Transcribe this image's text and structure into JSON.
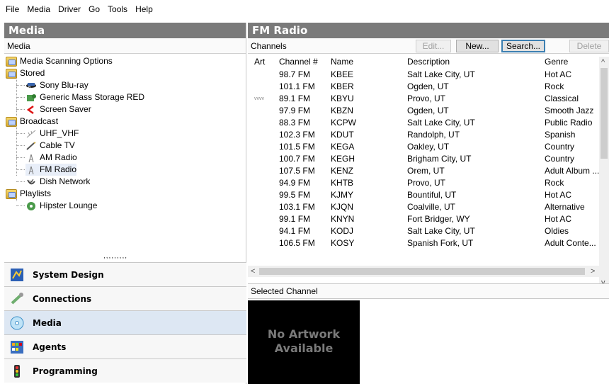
{
  "menu": [
    "File",
    "Media",
    "Driver",
    "Go",
    "Tools",
    "Help"
  ],
  "left": {
    "title": "Media",
    "subheader": "Media",
    "tree": [
      {
        "label": "Media Scanning Options",
        "icon": "folder-icon"
      },
      {
        "label": "Stored",
        "icon": "folder-icon"
      },
      {
        "label": "Sony Blu-ray",
        "icon": "bluray-player-icon"
      },
      {
        "label": "Generic Mass Storage RED",
        "icon": "storage-icon"
      },
      {
        "label": "Screen Saver",
        "icon": "screen-saver-icon"
      },
      {
        "label": "Broadcast",
        "icon": "folder-icon"
      },
      {
        "label": "UHF_VHF",
        "icon": "antenna-icon"
      },
      {
        "label": "Cable TV",
        "icon": "cable-icon"
      },
      {
        "label": "AM Radio",
        "icon": "radio-tower-icon"
      },
      {
        "label": "FM Radio",
        "icon": "radio-tower-icon"
      },
      {
        "label": "Dish Network",
        "icon": "satellite-dish-icon"
      },
      {
        "label": "Playlists",
        "icon": "folder-icon"
      },
      {
        "label": "Hipster Lounge",
        "icon": "playlist-icon"
      }
    ],
    "splitter": ",,,,,,,,,",
    "nav": [
      {
        "label": "System Design",
        "icon": "system-design-icon",
        "active": false
      },
      {
        "label": "Connections",
        "icon": "connections-icon",
        "active": false
      },
      {
        "label": "Media",
        "icon": "media-icon",
        "active": true
      },
      {
        "label": "Agents",
        "icon": "agents-icon",
        "active": false
      },
      {
        "label": "Programming",
        "icon": "programming-icon",
        "active": false
      }
    ]
  },
  "right": {
    "title": "FM Radio",
    "channels_label": "Channels",
    "buttons": {
      "edit": "Edit...",
      "new": "New...",
      "search": "Search...",
      "delete": "Delete"
    },
    "columns": [
      "Art",
      "Channel #",
      "Name",
      "Description",
      "Genre"
    ],
    "rows": [
      {
        "art": "",
        "channel": "98.7 FM",
        "name": "KBEE",
        "description": "Salt Lake City, UT",
        "genre": "Hot AC"
      },
      {
        "art": "",
        "channel": "101.1 FM",
        "name": "KBER",
        "description": "Ogden, UT",
        "genre": "Rock"
      },
      {
        "art": "vvvv",
        "channel": "89.1 FM",
        "name": "KBYU",
        "description": "Provo, UT",
        "genre": "Classical"
      },
      {
        "art": "",
        "channel": "97.9 FM",
        "name": "KBZN",
        "description": "Ogden, UT",
        "genre": "Smooth Jazz"
      },
      {
        "art": "",
        "channel": "88.3 FM",
        "name": "KCPW",
        "description": "Salt Lake City, UT",
        "genre": "Public Radio"
      },
      {
        "art": "",
        "channel": "102.3 FM",
        "name": "KDUT",
        "description": "Randolph, UT",
        "genre": "Spanish"
      },
      {
        "art": "",
        "channel": "101.5 FM",
        "name": "KEGA",
        "description": "Oakley, UT",
        "genre": "Country"
      },
      {
        "art": "",
        "channel": "100.7 FM",
        "name": "KEGH",
        "description": "Brigham City, UT",
        "genre": "Country"
      },
      {
        "art": "",
        "channel": "107.5 FM",
        "name": "KENZ",
        "description": "Orem, UT",
        "genre": "Adult Album ..."
      },
      {
        "art": "",
        "channel": "94.9 FM",
        "name": "KHTB",
        "description": "Provo, UT",
        "genre": "Rock"
      },
      {
        "art": "",
        "channel": "99.5 FM",
        "name": "KJMY",
        "description": "Bountiful, UT",
        "genre": "Hot AC"
      },
      {
        "art": "",
        "channel": "103.1 FM",
        "name": "KJQN",
        "description": "Coalville, UT",
        "genre": "Alternative"
      },
      {
        "art": "",
        "channel": "99.1 FM",
        "name": "KNYN",
        "description": "Fort Bridger, WY",
        "genre": "Hot AC"
      },
      {
        "art": "",
        "channel": "94.1 FM",
        "name": "KODJ",
        "description": "Salt Lake City, UT",
        "genre": "Oldies"
      },
      {
        "art": "",
        "channel": "106.5 FM",
        "name": "KOSY",
        "description": "Spanish Fork, UT",
        "genre": "Adult Conte..."
      }
    ],
    "selected_label": "Selected Channel",
    "artwork_line1": "No Artwork",
    "artwork_line2": "Available"
  }
}
